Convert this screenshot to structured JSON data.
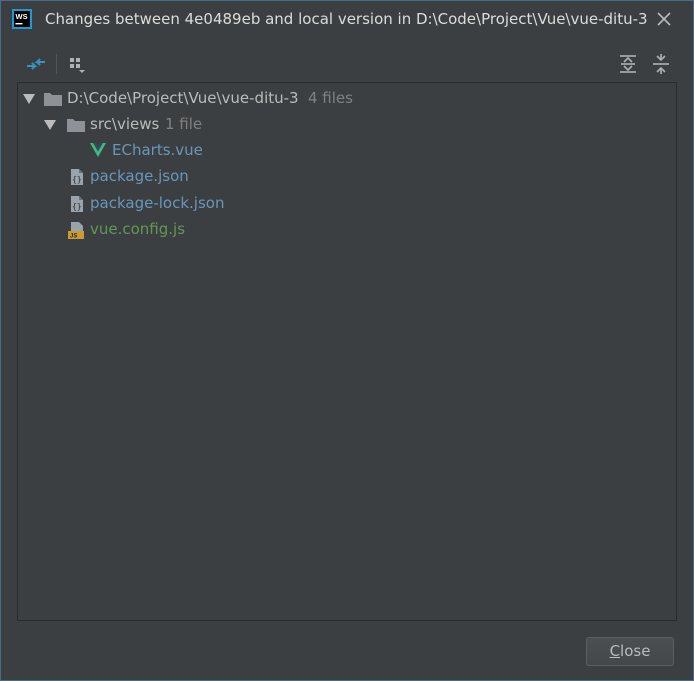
{
  "window": {
    "title": "Changes between 4e0489eb and local version in D:\\Code\\Project\\Vue\\vue-ditu-3",
    "app_icon": "webstorm-icon",
    "close_icon": "close-icon"
  },
  "toolbar": {
    "compare_icon": "compare-arrows-icon",
    "group_by_icon": "group-by-icon",
    "expand_all_icon": "expand-all-icon",
    "collapse_all_icon": "collapse-all-icon"
  },
  "tree": {
    "root": {
      "label": "D:\\Code\\Project\\Vue\\vue-ditu-3",
      "count": "4 files"
    },
    "folder": {
      "label": "src\\views",
      "count": "1 file"
    },
    "files": [
      {
        "label": "ECharts.vue",
        "icon": "vue-file-icon",
        "status_color": "#6897bb"
      },
      {
        "label": "package.json",
        "icon": "json-file-icon",
        "status_color": "#6897bb"
      },
      {
        "label": "package-lock.json",
        "icon": "json-file-icon",
        "status_color": "#6897bb"
      },
      {
        "label": "vue.config.js",
        "icon": "js-file-icon",
        "status_color": "#629755"
      }
    ]
  },
  "footer": {
    "close_mnemonic": "C",
    "close_rest": "lose"
  },
  "colors": {
    "background": "#3c3f41",
    "modified": "#6897bb",
    "added": "#629755",
    "hint": "#808080"
  }
}
